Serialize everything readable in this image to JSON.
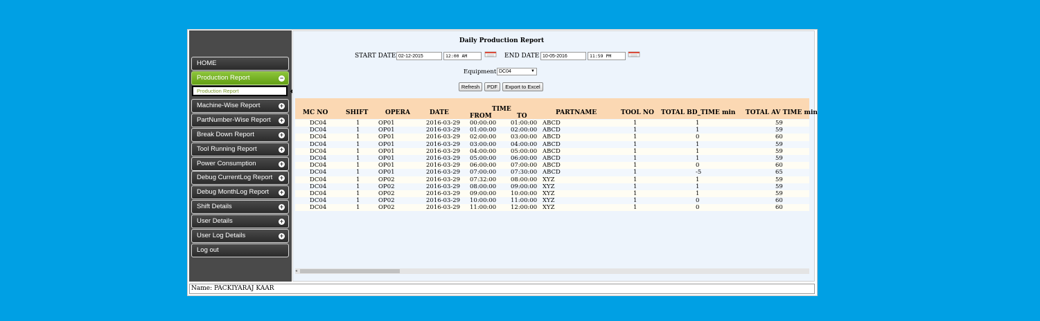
{
  "sidebar": {
    "items": [
      {
        "label": "HOME",
        "has_toggle": false
      },
      {
        "label": "Production Report",
        "has_toggle": true,
        "active": true,
        "toggle": "−"
      },
      {
        "label": "Machine-Wise Report",
        "has_toggle": true,
        "toggle": "+"
      },
      {
        "label": "PartNumber-Wise Report",
        "has_toggle": true,
        "toggle": "+"
      },
      {
        "label": "Break Down Report",
        "has_toggle": true,
        "toggle": "+"
      },
      {
        "label": "Tool Running Report",
        "has_toggle": true,
        "toggle": "+"
      },
      {
        "label": "Power Consumption",
        "has_toggle": true,
        "toggle": "+"
      },
      {
        "label": "Debug CurrentLog Report",
        "has_toggle": true,
        "toggle": "+"
      },
      {
        "label": "Debug MonthLog Report",
        "has_toggle": true,
        "toggle": "+"
      },
      {
        "label": "Shift Details",
        "has_toggle": true,
        "toggle": "+"
      },
      {
        "label": "User Details",
        "has_toggle": true,
        "toggle": "+"
      },
      {
        "label": "User Log Details",
        "has_toggle": true,
        "toggle": "+"
      },
      {
        "label": "Log out",
        "has_toggle": false
      }
    ],
    "submenu_label": "Production Report"
  },
  "report": {
    "title": "Daily Production Report",
    "start_date_label": "START DATE",
    "start_date": "02-12-2015",
    "start_time": "12:00 AM",
    "end_date_label": "END DATE",
    "end_date": "10-05-2016",
    "end_time": "11:59 PM",
    "equipment_label": "Equipment",
    "equipment_value": "DC04",
    "buttons": {
      "refresh": "Refresh",
      "pdf": "PDF",
      "export": "Export to Excel"
    }
  },
  "table": {
    "headers": {
      "mc_no": "MC NO",
      "shift": "SHIFT",
      "opera": "OPERA",
      "date": "DATE",
      "time": "TIME",
      "from": "FROM",
      "to": "TO",
      "partname": "PARTNAME",
      "tool_no": "TOOL NO",
      "total_bd": "TOTAL BD_TIME min",
      "total_av": "TOTAL AV TIME min"
    },
    "rows": [
      [
        "DC04",
        "1",
        "OP01",
        "2016-03-29",
        "00:00:00",
        "01:00:00",
        "ABCD",
        "1",
        "1",
        "59"
      ],
      [
        "DC04",
        "1",
        "OP01",
        "2016-03-29",
        "01:00:00",
        "02:00:00",
        "ABCD",
        "1",
        "1",
        "59"
      ],
      [
        "DC04",
        "1",
        "OP01",
        "2016-03-29",
        "02:00:00",
        "03:00:00",
        "ABCD",
        "1",
        "0",
        "60"
      ],
      [
        "DC04",
        "1",
        "OP01",
        "2016-03-29",
        "03:00:00",
        "04:00:00",
        "ABCD",
        "1",
        "1",
        "59"
      ],
      [
        "DC04",
        "1",
        "OP01",
        "2016-03-29",
        "04:00:00",
        "05:00:00",
        "ABCD",
        "1",
        "1",
        "59"
      ],
      [
        "DC04",
        "1",
        "OP01",
        "2016-03-29",
        "05:00:00",
        "06:00:00",
        "ABCD",
        "1",
        "1",
        "59"
      ],
      [
        "DC04",
        "1",
        "OP01",
        "2016-03-29",
        "06:00:00",
        "07:00:00",
        "ABCD",
        "1",
        "0",
        "60"
      ],
      [
        "DC04",
        "1",
        "OP01",
        "2016-03-29",
        "07:00:00",
        "07:30:00",
        "ABCD",
        "1",
        "-5",
        "65"
      ],
      [
        "DC04",
        "1",
        "OP02",
        "2016-03-29",
        "07:32:00",
        "08:00:00",
        "XYZ",
        "1",
        "1",
        "59"
      ],
      [
        "DC04",
        "1",
        "OP02",
        "2016-03-29",
        "08:00:00",
        "09:00:00",
        "XYZ",
        "1",
        "1",
        "59"
      ],
      [
        "DC04",
        "1",
        "OP02",
        "2016-03-29",
        "09:00:00",
        "10:00:00",
        "XYZ",
        "1",
        "1",
        "59"
      ],
      [
        "DC04",
        "1",
        "OP02",
        "2016-03-29",
        "10:00:00",
        "11:00:00",
        "XYZ",
        "1",
        "0",
        "60"
      ],
      [
        "DC04",
        "1",
        "OP02",
        "2016-03-29",
        "11:00:00",
        "12:00:00",
        "XYZ",
        "1",
        "0",
        "60"
      ]
    ]
  },
  "footer": {
    "name_text": "Name: PACKIYARAJ KAAR"
  }
}
